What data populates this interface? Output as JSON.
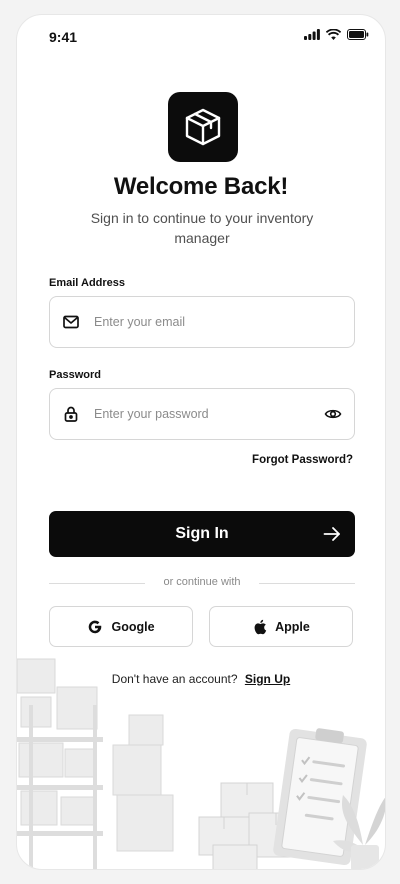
{
  "status_bar": {
    "time": "9:41"
  },
  "header": {
    "title": "Welcome Back!",
    "subtitle": "Sign in to continue to your inventory manager"
  },
  "form": {
    "email": {
      "label": "Email Address",
      "placeholder": "Enter your email",
      "value": ""
    },
    "password": {
      "label": "Password",
      "placeholder": "Enter your password",
      "value": ""
    },
    "forgot_label": "Forgot Password?",
    "submit_label": "Sign In"
  },
  "divider_text": "or continue with",
  "social": {
    "google_label": "Google",
    "apple_label": "Apple"
  },
  "footer": {
    "prompt": "Don't have an account?",
    "signup_label": "Sign Up"
  },
  "icons": {
    "logo": "box-icon",
    "email": "mail-icon",
    "password": "lock-icon",
    "toggle": "eye-icon",
    "submit": "arrow-right-icon"
  },
  "colors": {
    "primary": "#0b0b0b",
    "background": "#ffffff",
    "border": "#d6d6d6",
    "muted": "#8b8b8b"
  }
}
